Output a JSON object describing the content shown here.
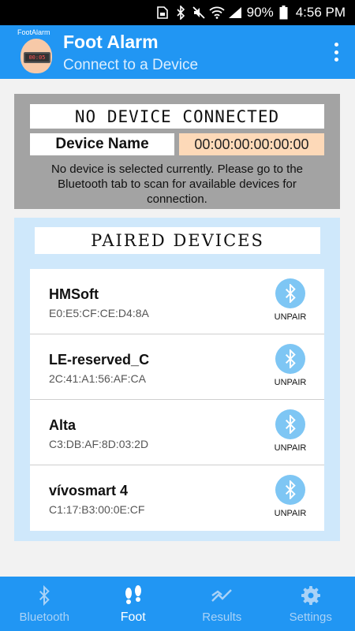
{
  "status_bar": {
    "battery_percent": "90%",
    "time": "4:56 PM",
    "icons": [
      "sim-card-icon",
      "bluetooth-icon",
      "mute-icon",
      "wifi-icon",
      "signal-icon",
      "battery-icon"
    ]
  },
  "app_bar": {
    "logo_text": "FootAlarm",
    "logo_display": "00:05",
    "title": "Foot Alarm",
    "subtitle": "Connect to a Device",
    "menu_icon": "overflow-menu-icon"
  },
  "connection": {
    "status": "NO DEVICE CONNECTED",
    "device_name_label": "Device Name",
    "mac_address": "00:00:00:00:00:00",
    "message": "No device is selected currently. Please go to the Bluetooth tab to scan for available devices for connection."
  },
  "paired": {
    "header": "PAIRED DEVICES",
    "unpair_label": "UNPAIR",
    "devices": [
      {
        "name": "HMSoft",
        "mac": "E0:E5:CF:CE:D4:8A"
      },
      {
        "name": "LE-reserved_C",
        "mac": "2C:41:A1:56:AF:CA"
      },
      {
        "name": "Alta",
        "mac": "C3:DB:AF:8D:03:2D"
      },
      {
        "name": "vívosmart 4",
        "mac": "C1:17:B3:00:0E:CF"
      }
    ]
  },
  "bottom_nav": {
    "items": [
      {
        "label": "Bluetooth",
        "icon": "bluetooth-icon",
        "active": false
      },
      {
        "label": "Foot",
        "icon": "footprints-icon",
        "active": true
      },
      {
        "label": "Results",
        "icon": "trend-chart-icon",
        "active": false
      },
      {
        "label": "Settings",
        "icon": "gear-icon",
        "active": false
      }
    ]
  },
  "colors": {
    "primary": "#2196f3",
    "panel_gray": "#a3a3a3",
    "panel_blue": "#cfe8fb",
    "mac_highlight": "#fdd9b8",
    "unpair_circle": "#7ec6f4"
  }
}
